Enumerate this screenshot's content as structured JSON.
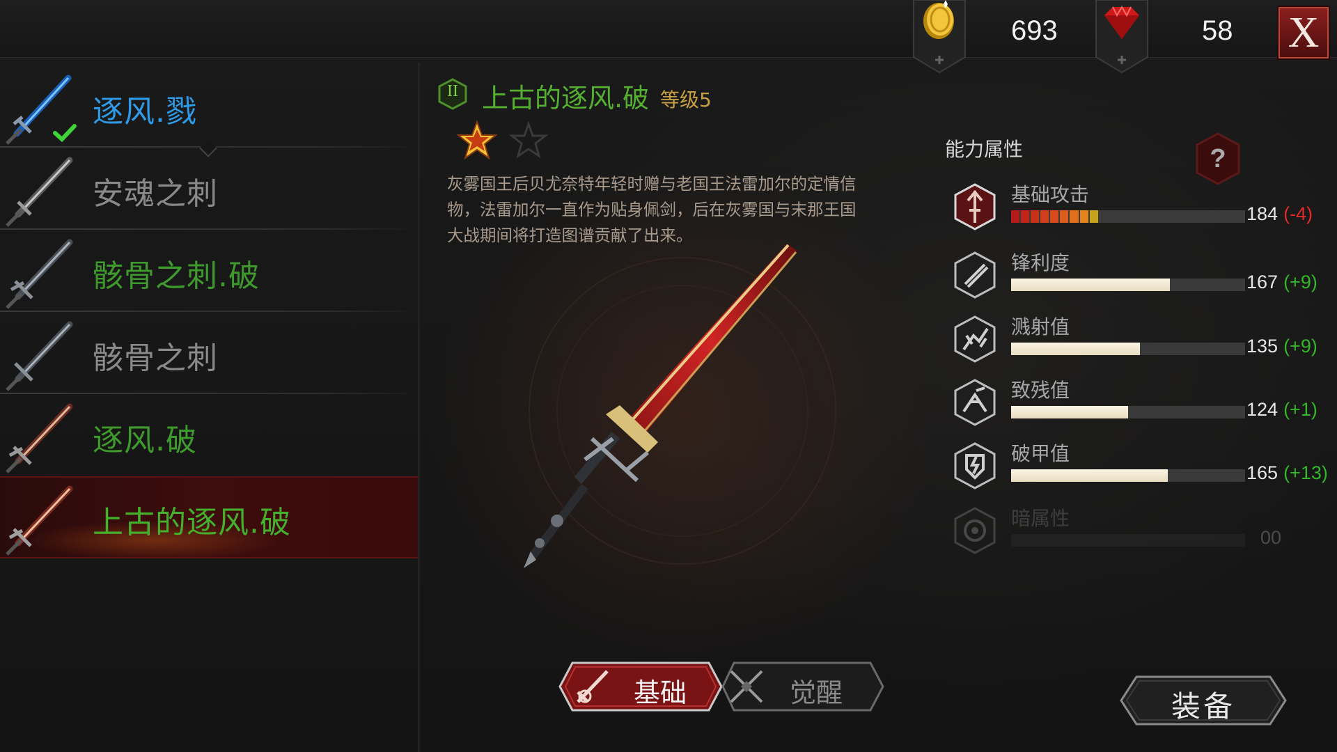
{
  "currency": {
    "gold": {
      "icon": "gold-coin-icon",
      "value": "693"
    },
    "gems": {
      "icon": "ruby-gem-icon",
      "value": "58"
    }
  },
  "close_label": "X",
  "weapons": [
    {
      "name": "逐风.戮",
      "color": "#2f9be8",
      "equipped": true
    },
    {
      "name": "安魂之刺",
      "color": "#8a8a8a"
    },
    {
      "name": "骸骨之刺.破",
      "color": "#3f9a2e"
    },
    {
      "name": "骸骨之刺",
      "color": "#8a8a8a"
    },
    {
      "name": "逐风.破",
      "color": "#3f9a2e"
    },
    {
      "name": "上古的逐风.破",
      "color": "#45b02c",
      "selected": true
    }
  ],
  "detail": {
    "grade_badge": "II",
    "name": "上古的逐风.破",
    "level": "等级5",
    "stars_filled": 1,
    "stars_total": 2,
    "description": "灰雾国王后贝尤奈特年轻时赠与老国王法雷加尔的定情信物，法雷加尔一直作为贴身佩剑，后在灰雾国与末那王国大战期间将打造图谱贡献了出来。"
  },
  "tabs": {
    "basic": "基础",
    "awaken": "觉醒"
  },
  "stats": {
    "title": "能力属性",
    "items": [
      {
        "name": "基础攻击",
        "icon": "attack-icon",
        "value": "184",
        "delta": "(-4)",
        "delta_color": "#e02a2a",
        "fill": 0.36,
        "segmented": true
      },
      {
        "name": "锋利度",
        "icon": "sharpness-icon",
        "value": "167",
        "delta": "(+9)",
        "delta_color": "#35b52a",
        "fill": 0.68
      },
      {
        "name": "溅射值",
        "icon": "splash-icon",
        "value": "135",
        "delta": "(+9)",
        "delta_color": "#35b52a",
        "fill": 0.55
      },
      {
        "name": "致残值",
        "icon": "cripple-icon",
        "value": "124",
        "delta": "(+1)",
        "delta_color": "#35b52a",
        "fill": 0.5
      },
      {
        "name": "破甲值",
        "icon": "armor-break-icon",
        "value": "165",
        "delta": "(+13)",
        "delta_color": "#35b52a",
        "fill": 0.67
      },
      {
        "name": "暗属性",
        "icon": "dark-element-icon",
        "value": "00",
        "delta": "",
        "delta_color": "#888888",
        "fill": 0,
        "disabled": true
      }
    ]
  },
  "equip_label": "装备"
}
